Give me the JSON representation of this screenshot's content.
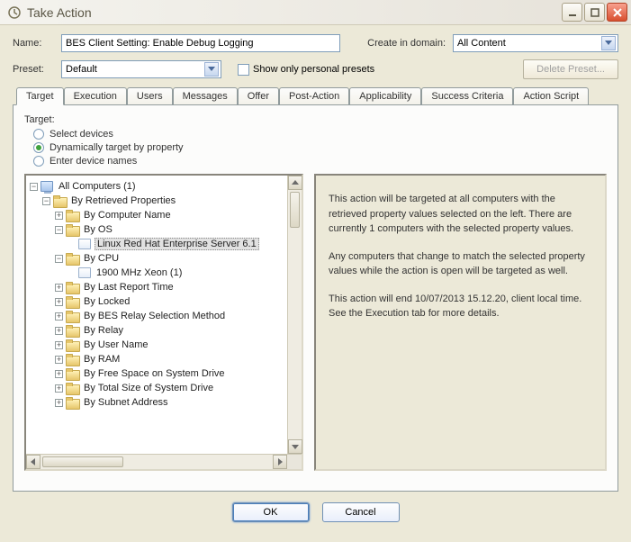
{
  "window": {
    "title": "Take Action"
  },
  "form": {
    "name_label": "Name:",
    "name_value": "BES Client Setting: Enable Debug Logging",
    "domain_label": "Create in domain:",
    "domain_value": "All Content",
    "preset_label": "Preset:",
    "preset_value": "Default",
    "show_personal_label": "Show only personal presets",
    "delete_preset_label": "Delete Preset..."
  },
  "tabs": [
    "Target",
    "Execution",
    "Users",
    "Messages",
    "Offer",
    "Post-Action",
    "Applicability",
    "Success Criteria",
    "Action Script"
  ],
  "target": {
    "heading": "Target:",
    "radios": {
      "select_devices": "Select devices",
      "dynamic": "Dynamically target by property",
      "enter_names": "Enter device names"
    }
  },
  "tree": {
    "root": "All Computers (1)",
    "by_retrieved": "By Retrieved Properties",
    "by_computer_name": "By Computer Name",
    "by_os": "By OS",
    "linux": "Linux Red Hat Enterprise Server 6.1",
    "by_cpu": "By CPU",
    "cpu_leaf": "1900 MHz Xeon (1)",
    "by_last_report": "By Last Report Time",
    "by_locked": "By Locked",
    "by_bes_relay": "By BES Relay Selection Method",
    "by_relay": "By Relay",
    "by_user_name": "By User Name",
    "by_ram": "By RAM",
    "by_free_space": "By Free Space on System Drive",
    "by_total_size": "By Total Size of System Drive",
    "by_subnet": "By Subnet Address"
  },
  "description": {
    "p1": "This action will be targeted at all computers with the retrieved property values selected on the left. There are currently 1 computers with the selected property values.",
    "p2": "Any computers that change to match the selected property values while the action is open will be targeted as well.",
    "p3": "This action will end 10/07/2013 15.12.20, client local time. See the Execution tab for more details."
  },
  "buttons": {
    "ok": "OK",
    "cancel": "Cancel"
  }
}
